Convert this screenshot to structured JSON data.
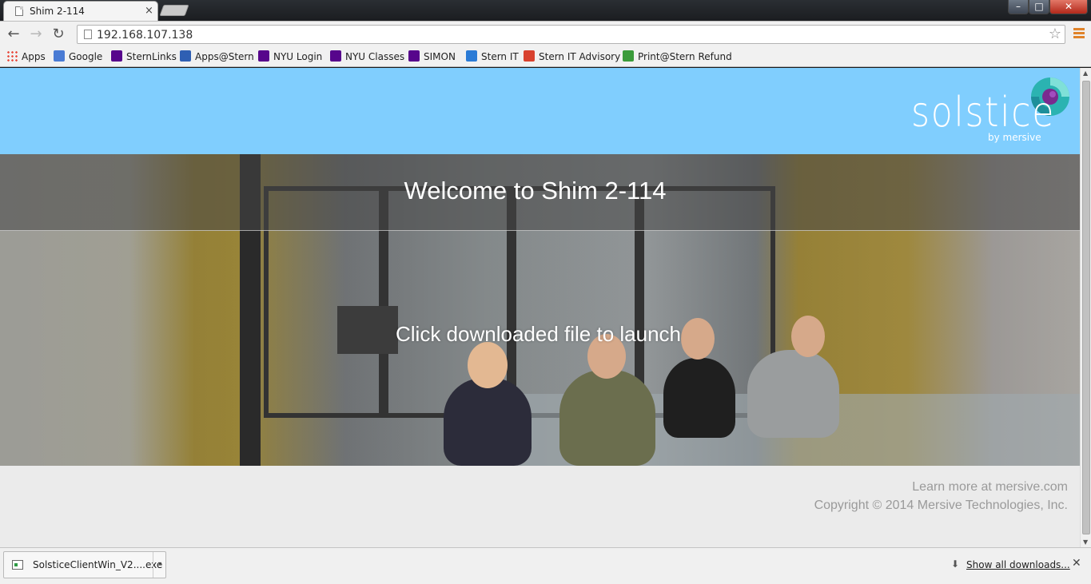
{
  "tab": {
    "title": "Shim 2-114",
    "close": "×"
  },
  "window_controls": {
    "minimize": "–",
    "maximize": "□",
    "close": "✕"
  },
  "toolbar": {
    "url": "192.168.107.138"
  },
  "bookmarks": [
    {
      "label": "Apps",
      "icon": "apps-grid-icon",
      "color": "#e8483b"
    },
    {
      "label": "Google",
      "icon": "google-icon",
      "color": "#4a7bd4"
    },
    {
      "label": "SternLinks",
      "icon": "nyu-torch-icon",
      "color": "#57068c"
    },
    {
      "label": "Apps@Stern",
      "icon": "apps-stern-icon",
      "color": "#2f5fb3"
    },
    {
      "label": "NYU Login",
      "icon": "nyu-torch-icon",
      "color": "#57068c"
    },
    {
      "label": "NYU Classes",
      "icon": "nyu-torch-icon",
      "color": "#57068c"
    },
    {
      "label": "SIMON",
      "icon": "nyu-torch-icon",
      "color": "#57068c"
    },
    {
      "label": "Stern IT",
      "icon": "trello-icon",
      "color": "#2b7bd6"
    },
    {
      "label": "Stern IT Advisory",
      "icon": "google-plus-icon",
      "color": "#d8412e"
    },
    {
      "label": "Print@Stern Refund",
      "icon": "print-refund-icon",
      "color": "#3a9b3a"
    }
  ],
  "page": {
    "logo": {
      "text": "solstice",
      "sub": "by mersive"
    },
    "welcome": "Welcome to Shim 2-114",
    "launch": "Click downloaded file to launch",
    "learn_more": "Learn more at mersive.com",
    "copyright": "Copyright © 2014 Mersive Technologies, Inc."
  },
  "downloads": {
    "file": "SolsticeClientWin_V2....exe",
    "show_all": "Show all downloads...",
    "close": "✕"
  },
  "colors": {
    "header": "#80cefe",
    "footer": "#ebebeb"
  }
}
